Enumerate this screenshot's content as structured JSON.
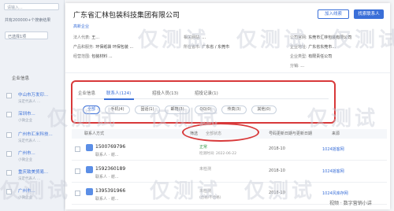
{
  "left_panel": {
    "search_placeholder": "请输入...",
    "count_text": "共有200000+个搜索结果",
    "filter_label": "已选择1项",
    "column_header": "企业信息",
    "items": [
      {
        "title": "中山市万发印...",
        "sub": "法定代表人 ..."
      },
      {
        "title": "深圳市...",
        "sub": "小微企业"
      },
      {
        "title": "广州市汇米科技...",
        "sub": "法定代表人 ..."
      },
      {
        "title": "广州市...",
        "sub": "小微企业"
      },
      {
        "title": "重庆致美贸易...",
        "sub": "法定代表人 ..."
      },
      {
        "title": "广州市...",
        "sub": "小微企业"
      }
    ]
  },
  "dialog": {
    "title": "广东省汇林包装科技集团有限公司",
    "tag": "高新企业",
    "buttons": {
      "secondary": "加入线索",
      "primary": "找索联系人"
    },
    "info": [
      {
        "k": "法人代表:",
        "v": "王..."
      },
      {
        "k": "相关网站:",
        "v": "..."
      },
      {
        "k": "公司官网:",
        "v": "东莞市汇林包装有限公司"
      },
      {
        "k": "产品和服务:",
        "v": "环保纸袋 环保包装 ..."
      },
      {
        "k": "所在省市:",
        "v": "广东省 / 东莞市"
      },
      {
        "k": "企业地址:",
        "v": "广东省东莞市..."
      },
      {
        "k": "经营范围:",
        "v": "包装材料 ..."
      },
      {
        "k": "企业类型:",
        "v": "有限责任公司"
      },
      {
        "k": "分销:",
        "v": "..."
      }
    ],
    "tabs": [
      {
        "label": "企业信息",
        "active": false
      },
      {
        "label": "联系人(124)",
        "active": true
      },
      {
        "label": "招投人员(13)",
        "active": false
      },
      {
        "label": "招投记录(1)",
        "active": false
      }
    ],
    "chips": [
      {
        "label": "全部",
        "active": true
      },
      {
        "label": "手机(4)",
        "active": false
      },
      {
        "label": "固话(1)",
        "active": false
      },
      {
        "label": "邮箱(3)",
        "active": false
      },
      {
        "label": "QQ(0)",
        "active": false
      },
      {
        "label": "传真(3)",
        "active": false
      },
      {
        "label": "其他(0)",
        "active": false
      }
    ],
    "table_headers": {
      "contact": "联系人方式",
      "filter": "筛选",
      "status": "号码状态",
      "status_hint": "全部状态",
      "updated": "号码更新日期与更新日期",
      "source": "来源"
    },
    "rows": [
      {
        "phone": "1500769796",
        "contact": "联系人 · 谢...",
        "status": "正常",
        "status2": "检测时间: 2022-06-22",
        "date": "2018-10",
        "source": "1024摇客网"
      },
      {
        "phone": "1592360189",
        "contact": "联系人 · 谢...",
        "status": "未检测",
        "status2": "",
        "date": "2018-10",
        "source": "1024摇客网"
      },
      {
        "phone": "1395391966",
        "contact": "联系人 · 谢...",
        "status": "未检测",
        "status2": "(合格/不合格)",
        "date": "2018-10",
        "source": "1024风库存网"
      }
    ]
  },
  "watermarks": [
    "仅测试",
    "仅测试",
    "仅测试",
    "仅测试",
    "仅测试",
    "仅测试",
    "仅测试",
    "仅测试",
    "仅测试"
  ],
  "wechat_caption": "视频 · 数字营销小讲"
}
